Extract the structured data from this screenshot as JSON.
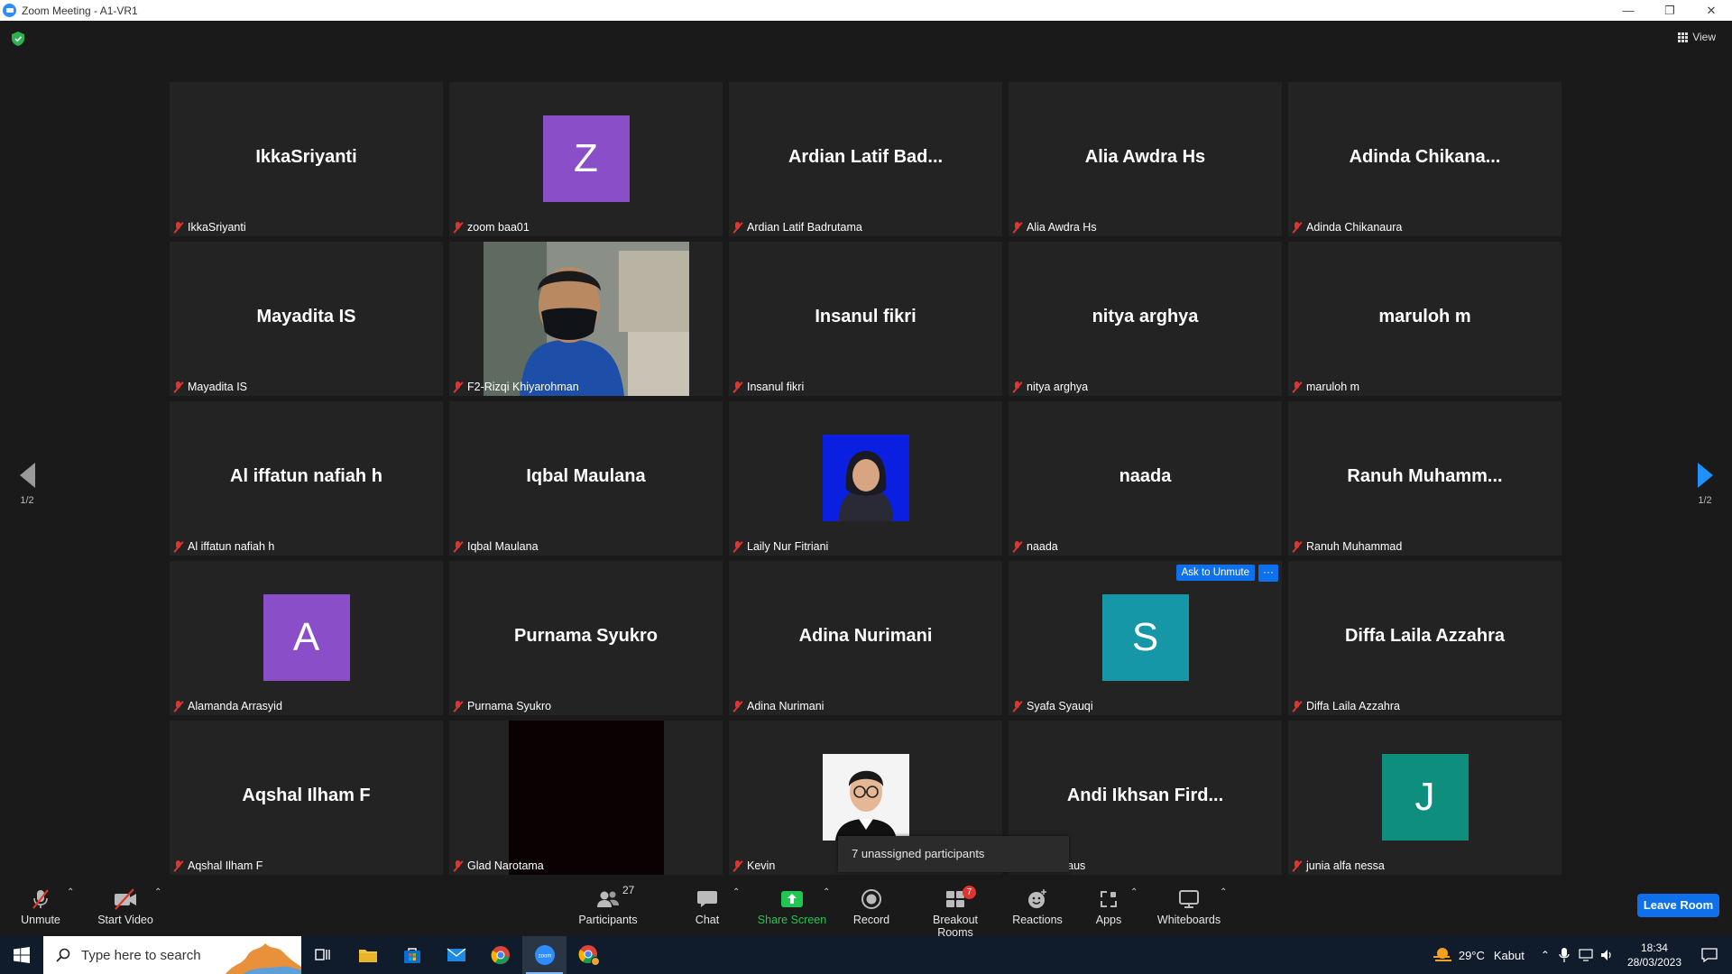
{
  "window": {
    "title": "Zoom Meeting - A1-VR1"
  },
  "top": {
    "view_label": "View"
  },
  "pager": {
    "left": "1/2",
    "right": "1/2"
  },
  "tiles": [
    {
      "display": "IkkaSriyanti",
      "name": "IkkaSriyanti",
      "kind": "text"
    },
    {
      "display": "Z",
      "name": "zoom baa01",
      "kind": "avatar",
      "color": "#8a4fc8"
    },
    {
      "display": "Ardian Latif Bad...",
      "name": "Ardian Latif Badrutama",
      "kind": "text"
    },
    {
      "display": "Alia Awdra Hs",
      "name": "Alia Awdra Hs",
      "kind": "text"
    },
    {
      "display": "Adinda  Chikana...",
      "name": "Adinda Chikanaura",
      "kind": "text"
    },
    {
      "display": "Mayadita IS",
      "name": "Mayadita IS",
      "kind": "text"
    },
    {
      "display": "",
      "name": "F2-Rizqi Khiyarohman",
      "kind": "video"
    },
    {
      "display": "Insanul fikri",
      "name": "Insanul fikri",
      "kind": "text"
    },
    {
      "display": "nitya arghya",
      "name": "nitya arghya",
      "kind": "text"
    },
    {
      "display": "maruloh m",
      "name": "maruloh m",
      "kind": "text"
    },
    {
      "display": "Al iffatun nafiah h",
      "name": "Al iffatun nafiah h",
      "kind": "text"
    },
    {
      "display": "Iqbal Maulana",
      "name": "Iqbal Maulana",
      "kind": "text"
    },
    {
      "display": "",
      "name": "Laily Nur Fitriani",
      "kind": "photo-blue"
    },
    {
      "display": "naada",
      "name": "naada",
      "kind": "text"
    },
    {
      "display": "Ranuh  Muhamm...",
      "name": "Ranuh Muhammad",
      "kind": "text"
    },
    {
      "display": "A",
      "name": "Alamanda Arrasyid",
      "kind": "avatar",
      "color": "#8a4fc8"
    },
    {
      "display": "Purnama Syukro",
      "name": "Purnama Syukro",
      "kind": "text"
    },
    {
      "display": "Adina Nurimani",
      "name": "Adina Nurimani",
      "kind": "text"
    },
    {
      "display": "S",
      "name": "Syafa Syauqi",
      "kind": "avatar",
      "color": "#1597a8",
      "hover": true
    },
    {
      "display": "Diffa Laila Azzahra",
      "name": "Diffa Laila Azzahra",
      "kind": "text"
    },
    {
      "display": "Aqshal Ilham F",
      "name": "Aqshal Ilham F",
      "kind": "text"
    },
    {
      "display": "",
      "name": "Glad Narotama",
      "kind": "video-dark"
    },
    {
      "display": "",
      "name": "Kevin",
      "kind": "photo-white"
    },
    {
      "display": "Andi  Ikhsan  Fird...",
      "name": "san Firdaus",
      "kind": "text"
    },
    {
      "display": "J",
      "name": "junia alfa nessa",
      "kind": "avatar",
      "color": "#0e8f7e"
    }
  ],
  "hover_actions": {
    "ask_unmute": "Ask to Unmute",
    "more": "···"
  },
  "tooltip": "7 unassigned participants",
  "toolbar": {
    "unmute": "Unmute",
    "start_video": "Start Video",
    "participants": "Participants",
    "participants_count": "27",
    "chat": "Chat",
    "share_screen": "Share Screen",
    "record": "Record",
    "breakout_rooms": "Breakout Rooms",
    "breakout_badge": "7",
    "reactions": "Reactions",
    "apps": "Apps",
    "whiteboards": "Whiteboards",
    "leave_room": "Leave Room"
  },
  "taskbar": {
    "search_placeholder": "Type here to search",
    "weather_temp": "29°C",
    "weather_text": "Kabut",
    "time": "18:34",
    "date": "28/03/2023"
  },
  "colors": {
    "accent": "#0e71eb",
    "muted_red": "#e0342f",
    "share_green": "#23c552"
  }
}
